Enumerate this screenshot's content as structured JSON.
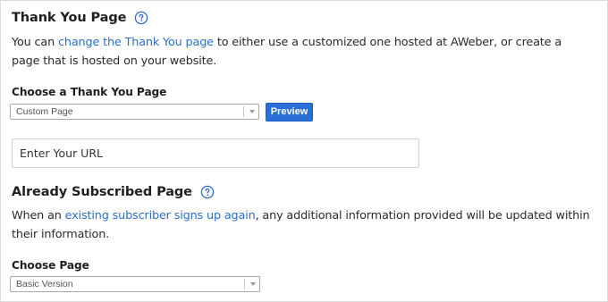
{
  "thank_you": {
    "title": "Thank You Page",
    "desc_prefix": "You can ",
    "desc_link": "change the Thank You page",
    "desc_suffix": " to either use a customized one hosted at AWeber, or create a page that is hosted on your website.",
    "choose_label": "Choose a Thank You Page",
    "select_value": "Custom Page",
    "preview_label": "Preview",
    "url_placeholder": "Enter Your URL"
  },
  "already_subscribed": {
    "title": "Already Subscribed Page",
    "desc_prefix": "When an ",
    "desc_link": "existing subscriber signs up again",
    "desc_suffix": ", any additional information provided will be updated within their information.",
    "choose_label": "Choose Page",
    "select_value": "Basic Version"
  },
  "colors": {
    "link": "#2c6ecb",
    "button": "#2b6fd6",
    "help_icon": "#2c6ecb"
  },
  "icons": {
    "help": "question-circle-icon",
    "dropdown": "caret-down-icon"
  }
}
